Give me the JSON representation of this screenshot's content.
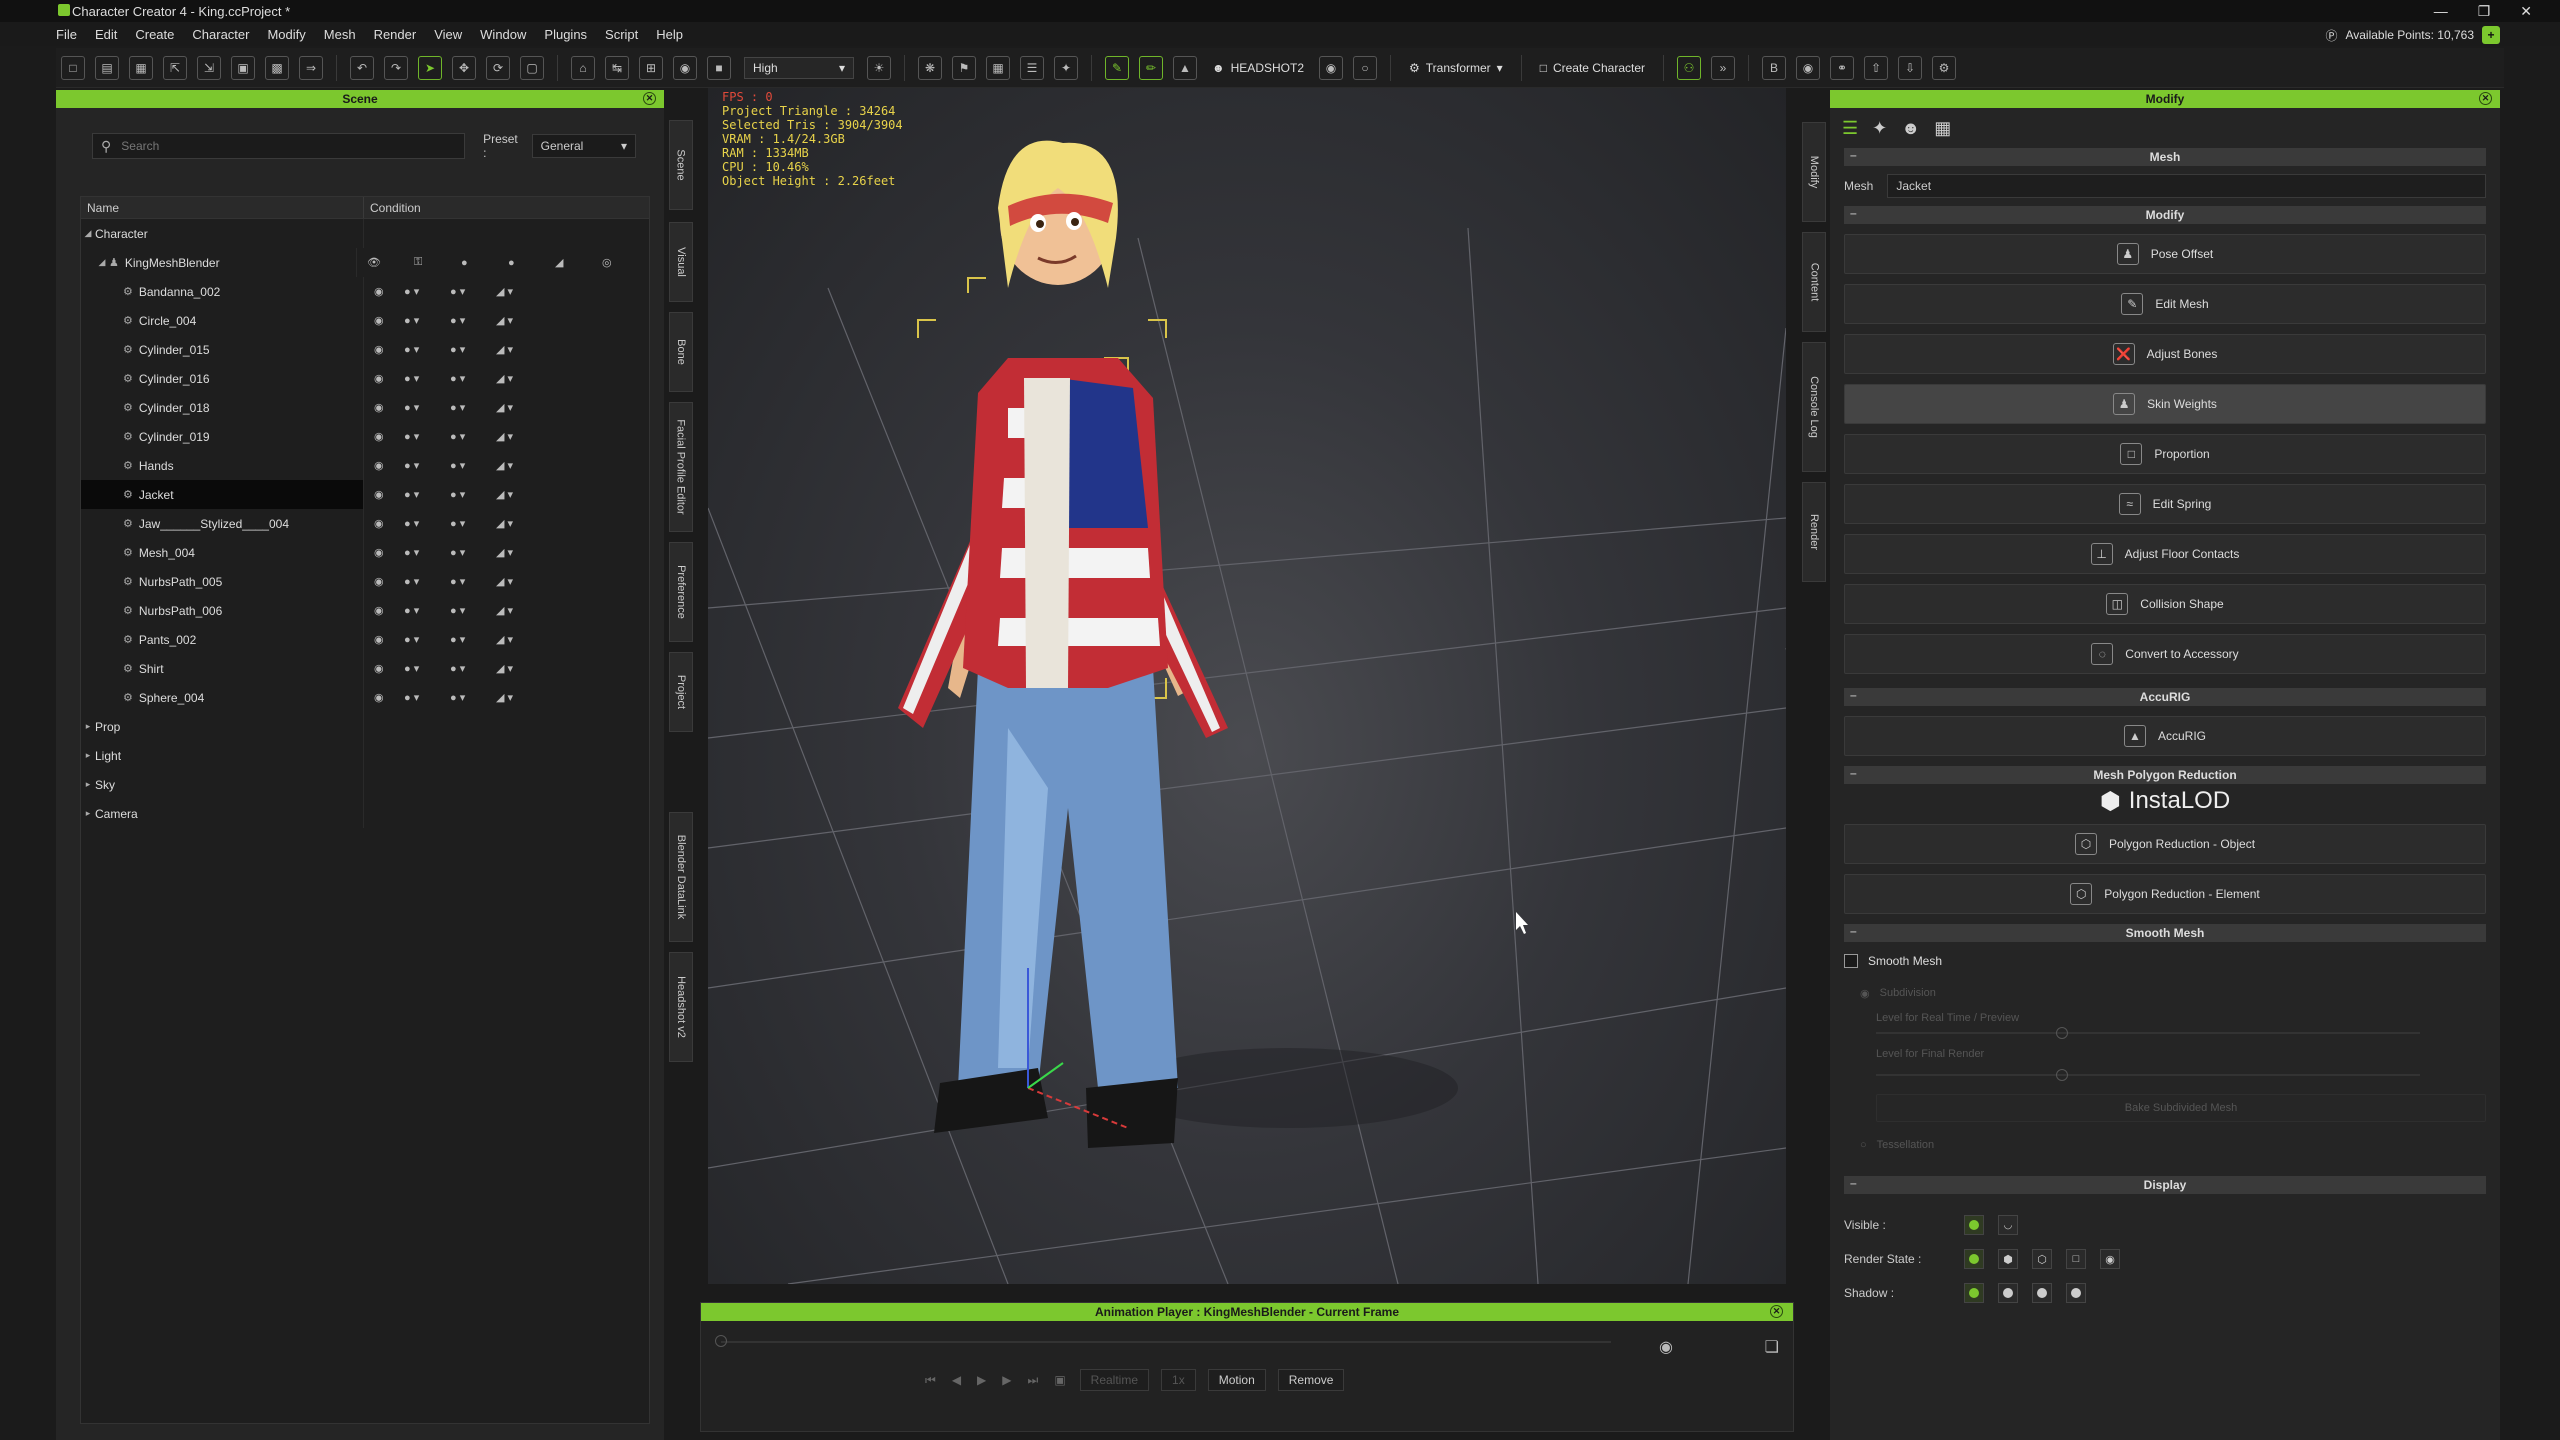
{
  "window": {
    "title": "Character Creator 4 - King.ccProject *"
  },
  "menu": [
    "File",
    "Edit",
    "Create",
    "Character",
    "Modify",
    "Mesh",
    "Render",
    "View",
    "Window",
    "Plugins",
    "Script",
    "Help"
  ],
  "points": {
    "label": "Available Points: 10,763"
  },
  "toolbar": {
    "quality": "High",
    "headshot": "HEADSHOT2",
    "transformer": "Transformer",
    "create_character": "Create Character"
  },
  "scene": {
    "title": "Scene",
    "search_placeholder": "Search",
    "preset_label": "Preset :",
    "preset_value": "General",
    "col_name": "Name",
    "col_condition": "Condition",
    "root": "Character",
    "group": "KingMeshBlender",
    "items": [
      "Bandanna_002",
      "Circle_004",
      "Cylinder_015",
      "Cylinder_016",
      "Cylinder_018",
      "Cylinder_019",
      "Hands",
      "Jacket",
      "Jaw______Stylized____004",
      "Mesh_004",
      "NurbsPath_005",
      "NurbsPath_006",
      "Pants_002",
      "Shirt",
      "Sphere_004"
    ],
    "selected": "Jacket",
    "others": [
      "Prop",
      "Light",
      "Sky",
      "Camera"
    ]
  },
  "vtabs_left": [
    "Scene",
    "Visual",
    "Bone",
    "Facial Profile Editor",
    "Preference",
    "Project",
    "Blender DataLink",
    "Headshot v2"
  ],
  "vtabs_right": [
    "Modify",
    "Content",
    "Console Log",
    "Render"
  ],
  "viewport": {
    "stats": [
      "FPS : 0",
      "Project Triangle : 34264",
      "Selected Tris : 3904/3904",
      "VRAM : 1.4/24.3GB",
      "RAM : 1334MB",
      "CPU : 10.46%",
      "Object Height : 2.26feet"
    ]
  },
  "anim": {
    "title": "Animation Player : KingMeshBlender - Current Frame",
    "realtime": "Realtime",
    "speed": "1x",
    "motion": "Motion",
    "remove": "Remove"
  },
  "modify": {
    "title": "Modify",
    "mesh_section": "Mesh",
    "mesh_label": "Mesh",
    "mesh_value": "Jacket",
    "modify_section": "Modify",
    "buttons": [
      "Pose Offset",
      "Edit Mesh",
      "Adjust Bones",
      "Skin Weights",
      "Proportion",
      "Edit Spring",
      "Adjust Floor Contacts",
      "Collision Shape",
      "Convert to Accessory"
    ],
    "accurig_section": "AccuRIG",
    "accurig_button": "AccuRIG",
    "poly_section": "Mesh Polygon Reduction",
    "instalod": "InstaLOD",
    "poly_buttons": [
      "Polygon Reduction - Object",
      "Polygon Reduction - Element"
    ],
    "smooth_section": "Smooth Mesh",
    "smooth_label": "Smooth Mesh",
    "subdivision": "Subdivision",
    "level_rt": "Level for Real Time / Preview",
    "level_final": "Level for Final Render",
    "bake": "Bake Subdivided Mesh",
    "tessellation": "Tessellation",
    "display_section": "Display",
    "visible": "Visible :",
    "render_state": "Render State :",
    "shadow": "Shadow :"
  },
  "colors": {
    "accent": "#7cc82e"
  }
}
